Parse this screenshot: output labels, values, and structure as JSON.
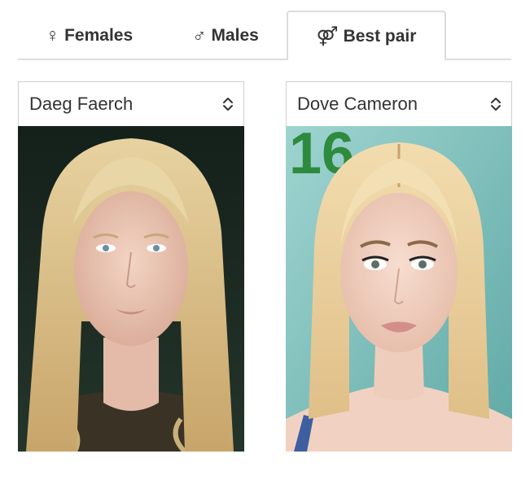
{
  "tabs": [
    {
      "symbol": "♀",
      "label": "Females",
      "icon": "female-icon"
    },
    {
      "symbol": "♂",
      "label": "Males",
      "icon": "male-icon"
    },
    {
      "symbol": "⚤",
      "label": "Best pair",
      "icon": "pair-icon",
      "active": true
    }
  ],
  "left": {
    "selected": "Daeg Faerch",
    "photo_alt": "Daeg Faerch"
  },
  "right": {
    "selected": "Dove Cameron",
    "photo_alt": "Dove Cameron",
    "backdrop_text": "16"
  },
  "colors": {
    "tab_border": "#dcdcdc",
    "text": "#333333",
    "left_bg": "#1c2a22",
    "right_bg": "#8cc8c4",
    "backdrop_green": "#2e8b3e"
  }
}
